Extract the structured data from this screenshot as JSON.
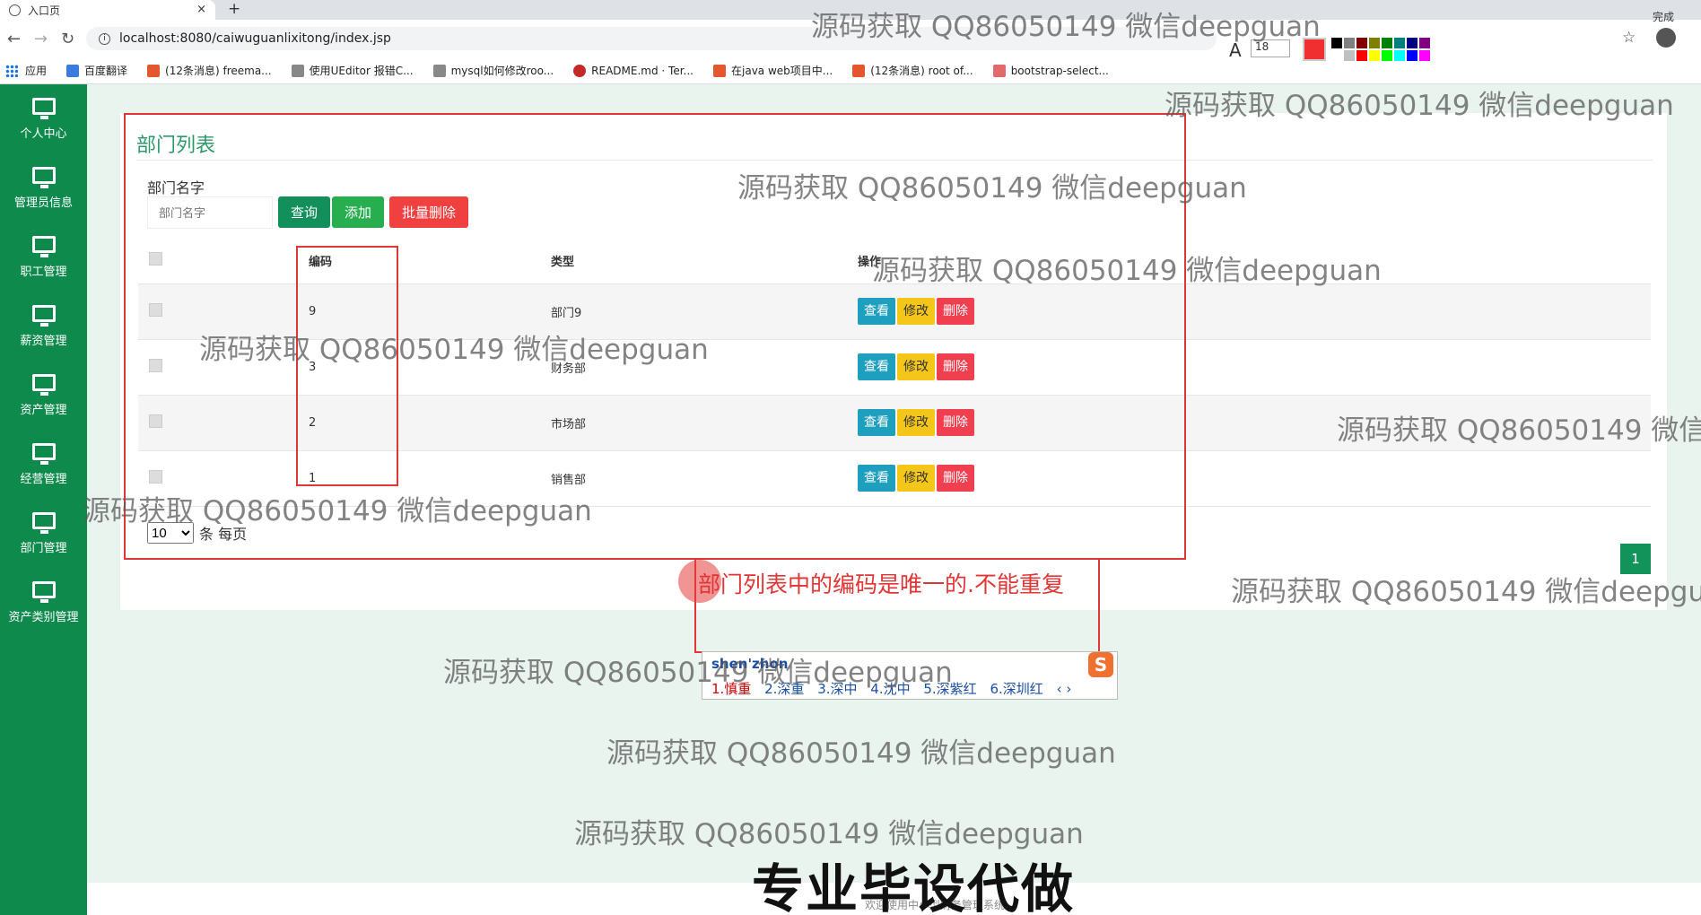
{
  "browser": {
    "tab_title": "入口页",
    "tab_close": "×",
    "new_tab": "+",
    "url": "localhost:8080/caiwuguanlixitong/index.jsp",
    "bookmarks": [
      "应用",
      "百度翻译",
      "(12条消息) freema...",
      "使用UEditor 报错C...",
      "mysql如何修改roo...",
      "README.md · Ter...",
      "在java web项目中...",
      "(12条消息) root of...",
      "bootstrap-select..."
    ]
  },
  "screenshot_tool": {
    "font_size": "18",
    "done_label": "完成",
    "colors": [
      "#000000",
      "#808080",
      "#800000",
      "#808000",
      "#008000",
      "#008080",
      "#000080",
      "#800080",
      "#ffffff",
      "#c0c0c0",
      "#ff0000",
      "#ffff00",
      "#00ff00",
      "#00ffff",
      "#0000ff",
      "#ff00ff"
    ]
  },
  "sidebar": {
    "items": [
      "个人中心",
      "管理员信息",
      "职工管理",
      "薪资管理",
      "资产管理",
      "经营管理",
      "部门管理",
      "资产类别管理"
    ]
  },
  "panel": {
    "title": "部门列表",
    "search_label": "部门名字",
    "search_placeholder": "部门名字",
    "btn_query": "查询",
    "btn_add": "添加",
    "btn_batch_delete": "批量删除"
  },
  "table": {
    "headers": [
      "",
      "编码",
      "类型",
      "操作"
    ],
    "rows": [
      {
        "code": "9",
        "type": "部门9"
      },
      {
        "code": "3",
        "type": "财务部"
      },
      {
        "code": "2",
        "type": "市场部"
      },
      {
        "code": "1",
        "type": "销售部"
      }
    ],
    "ops": {
      "view": "查看",
      "edit": "修改",
      "delete": "删除"
    }
  },
  "pager": {
    "page_size": "10",
    "per_page_label": "条 每页",
    "current_page": "1"
  },
  "annotation": "部门列表中的编码是唯一的.不能重复",
  "ime": {
    "pinyin": "shen'zhon",
    "candidates": [
      "1.慎重",
      "2.深重",
      "3.深中",
      "4.沈中",
      "5.深紫红",
      "6.深圳红"
    ],
    "nav": "‹ ›"
  },
  "watermark": "源码获取 QQ86050149 微信deepguan",
  "watermark_partial": "源码获取 QQ86050149 微信d",
  "watermark_partial2": "源码获取 QQ86050149 微信deepgua",
  "big_caption": "专业毕设代做",
  "footer": "欢迎使用中小型财务管理系统"
}
